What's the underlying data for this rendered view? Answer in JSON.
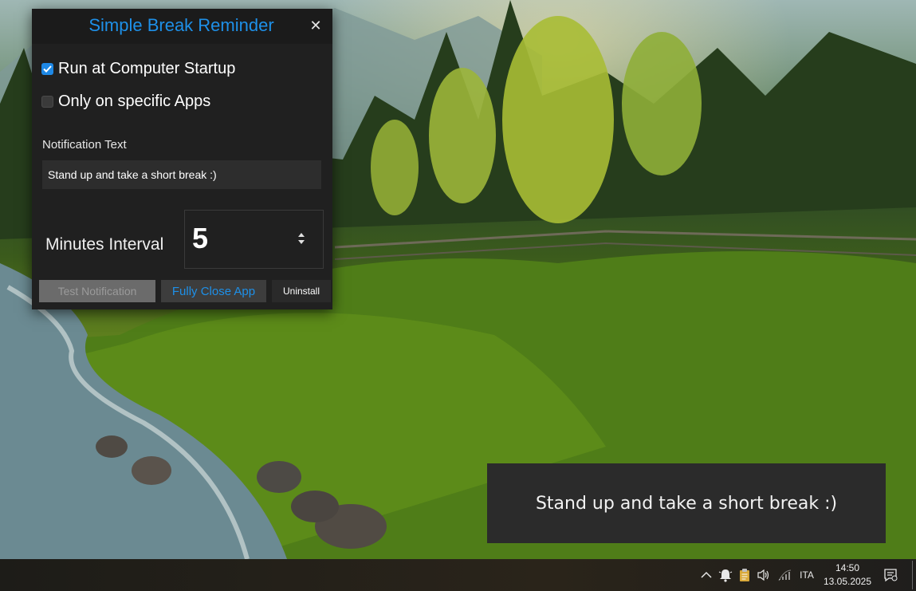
{
  "app": {
    "title": "Simple Break Reminder",
    "close_glyph": "✕",
    "options": [
      {
        "label": "Run at Computer Startup",
        "checked": true
      },
      {
        "label": "Only on specific Apps",
        "checked": false
      }
    ],
    "notification_label": "Notification Text",
    "notification_value": "Stand up and take a short break :)",
    "minutes_label": "Minutes Interval",
    "minutes_value": "5",
    "buttons": {
      "test": "Test Notification",
      "fully_close": "Fully Close App",
      "uninstall": "Uninstall"
    },
    "accent_color": "#1e90e8"
  },
  "toast": {
    "text": "Stand up and take a short break :)"
  },
  "taskbar": {
    "tray_icons": [
      "chevron-up-icon",
      "bell-icon",
      "clipboard-icon",
      "speaker-icon",
      "wifi-icon"
    ],
    "language": "ITA",
    "time": "14:50",
    "date": "13.05.2025",
    "notification_center_icon": "notification-center-icon"
  }
}
